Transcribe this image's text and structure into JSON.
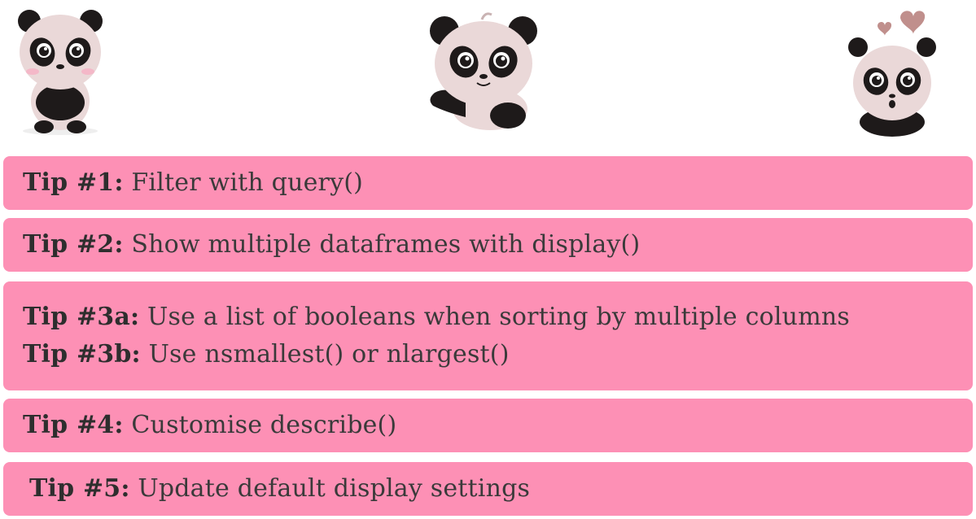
{
  "colors": {
    "tip_background": "#fd90b5",
    "text": "#3a3a3a",
    "panda_black": "#1e1a1a",
    "panda_face": "#ead8d8",
    "heart": "#c08f8c"
  },
  "decorations": {
    "left": "panda-shy-icon",
    "center": "panda-pointing-icon",
    "right": "panda-surprised-hearts-icon"
  },
  "tips": [
    {
      "label": "Tip #1:",
      "text": "Filter with query()"
    },
    {
      "label": "Tip #2:",
      "text": "Show multiple dataframes with display()"
    },
    {
      "label": "Tip #3a:",
      "text": "Use a list of booleans when sorting by multiple columns"
    },
    {
      "label": "Tip #3b:",
      "text": "Use nsmallest() or nlargest()"
    },
    {
      "label": "Tip #4:",
      "text": "Customise describe()"
    },
    {
      "label": "Tip #5:",
      "text": "Update default display settings"
    }
  ]
}
